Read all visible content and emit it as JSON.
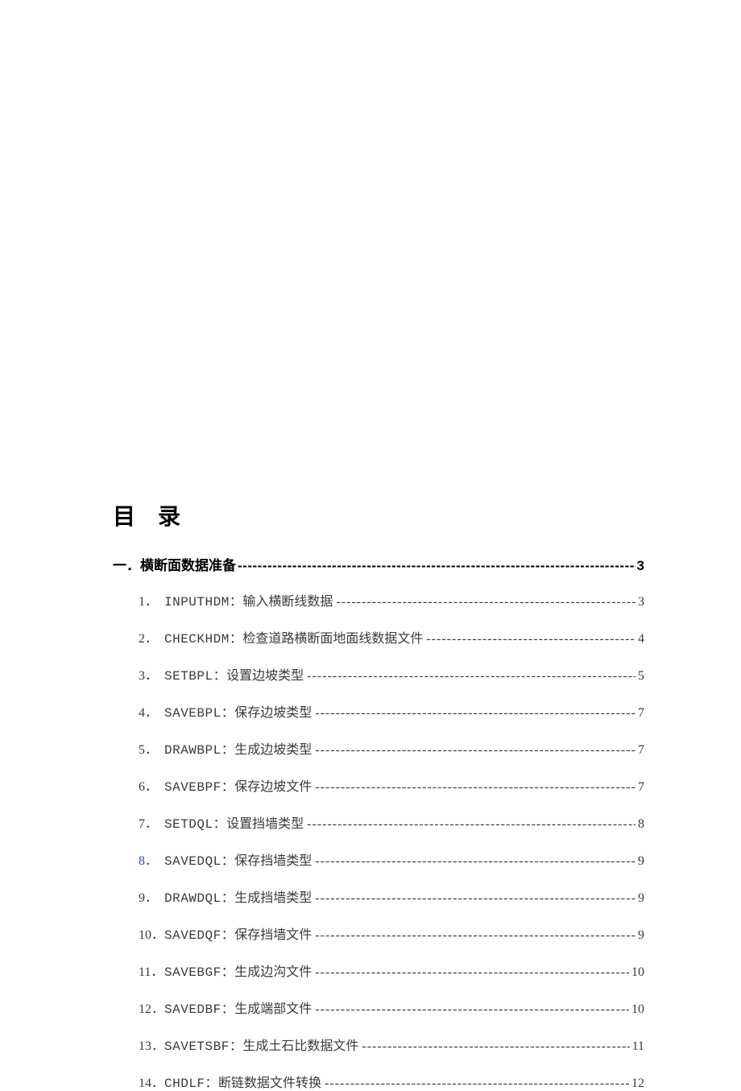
{
  "title": "目录",
  "section": {
    "label": "一．横断面数据准备",
    "page": "3"
  },
  "items": [
    {
      "num": "1．",
      "cmd": "INPUTHDM：",
      "desc": "输入横断线数据",
      "page": "3",
      "blue": false
    },
    {
      "num": "2．",
      "cmd": "CHECKHDM：",
      "desc": "检查道路横断面地面线数据文件",
      "page": "4",
      "blue": false
    },
    {
      "num": "3．",
      "cmd": "SETBPL：",
      "desc": "设置边坡类型",
      "page": "5",
      "blue": false
    },
    {
      "num": "4．",
      "cmd": "SAVEBPL：",
      "desc": "保存边坡类型",
      "page": "7",
      "blue": false
    },
    {
      "num": "5．",
      "cmd": "DRAWBPL：",
      "desc": "生成边坡类型",
      "page": "7",
      "blue": false
    },
    {
      "num": "6．",
      "cmd": "SAVEBPF：",
      "desc": "保存边坡文件",
      "page": "7",
      "blue": false
    },
    {
      "num": "7．",
      "cmd": "SETDQL：",
      "desc": "设置挡墙类型",
      "page": "8",
      "blue": false
    },
    {
      "num": "8．",
      "cmd": "SAVEDQL：",
      "desc": "保存挡墙类型",
      "page": "9",
      "blue": true
    },
    {
      "num": "9．",
      "cmd": "DRAWDQL：",
      "desc": "生成挡墙类型",
      "page": "9",
      "blue": false
    },
    {
      "num": "10．",
      "cmd": "SAVEDQF：",
      "desc": "保存挡墙文件",
      "page": "9",
      "blue": false
    },
    {
      "num": "11．",
      "cmd": "SAVEBGF：",
      "desc": "生成边沟文件",
      "page": "10",
      "blue": false
    },
    {
      "num": "12．",
      "cmd": "SAVEDBF：",
      "desc": "生成端部文件",
      "page": "10",
      "blue": false
    },
    {
      "num": "13．",
      "cmd": "SAVETSBF：",
      "desc": "生成土石比数据文件",
      "page": "11",
      "blue": false
    },
    {
      "num": "14．",
      "cmd": "CHDLF：",
      "desc": "断链数据文件转换",
      "page": "12",
      "blue": false
    }
  ]
}
